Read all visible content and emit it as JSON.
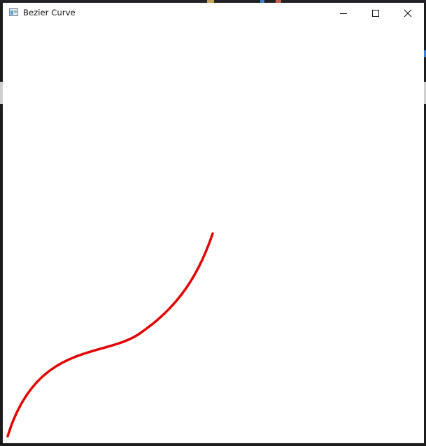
{
  "window": {
    "title": "Bezier Curve",
    "icon": "app-window-icon"
  },
  "caption_buttons": {
    "minimize_icon": "minimize-icon",
    "maximize_icon": "maximize-icon",
    "close_icon": "close-icon"
  },
  "canvas": {
    "background": "#ffffff",
    "curve": {
      "color": "#e30000",
      "shape": "cubic-bezier"
    }
  }
}
